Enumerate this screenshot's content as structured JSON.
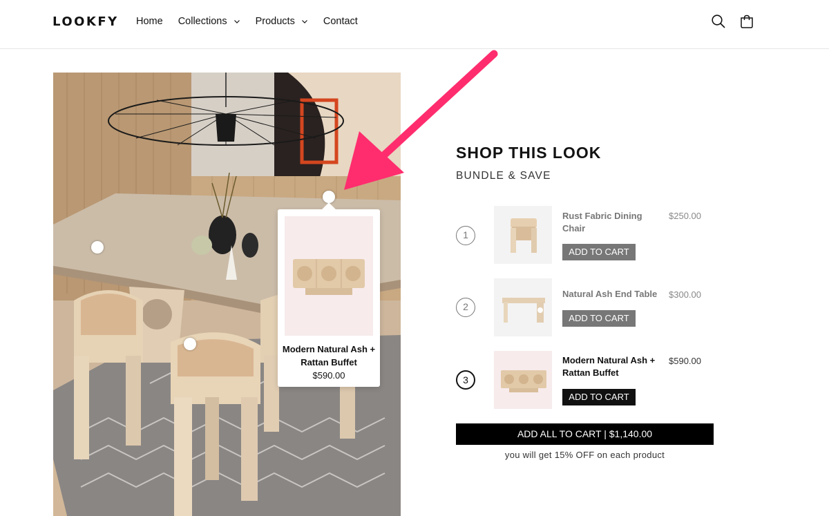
{
  "header": {
    "logo": "LOOKFY",
    "nav": [
      {
        "label": "Home",
        "has_dropdown": false
      },
      {
        "label": "Collections",
        "has_dropdown": true
      },
      {
        "label": "Products",
        "has_dropdown": true
      },
      {
        "label": "Contact",
        "has_dropdown": false
      }
    ],
    "icons": [
      "search-icon",
      "cart-icon"
    ]
  },
  "popover": {
    "title": "Modern Natural Ash + Rattan Buffet",
    "price": "$590.00"
  },
  "shop": {
    "title": "SHOP THIS LOOK",
    "subtitle": "BUNDLE & SAVE",
    "items": [
      {
        "number": "1",
        "name": "Rust Fabric Dining Chair",
        "price": "$250.00",
        "button": "ADD TO CART",
        "active": false
      },
      {
        "number": "2",
        "name": "Natural Ash End Table",
        "price": "$300.00",
        "button": "ADD TO CART",
        "active": false
      },
      {
        "number": "3",
        "name": "Modern Natural Ash + Rattan Buffet",
        "price": "$590.00",
        "button": "ADD TO CART",
        "active": true
      }
    ],
    "add_all_label": "ADD ALL TO CART | $1,140.00",
    "discount_note": "you will get 15% OFF on each product"
  },
  "colors": {
    "accent_arrow": "#ff2d6e",
    "primary_button": "#000000",
    "muted_button": "#777777"
  }
}
